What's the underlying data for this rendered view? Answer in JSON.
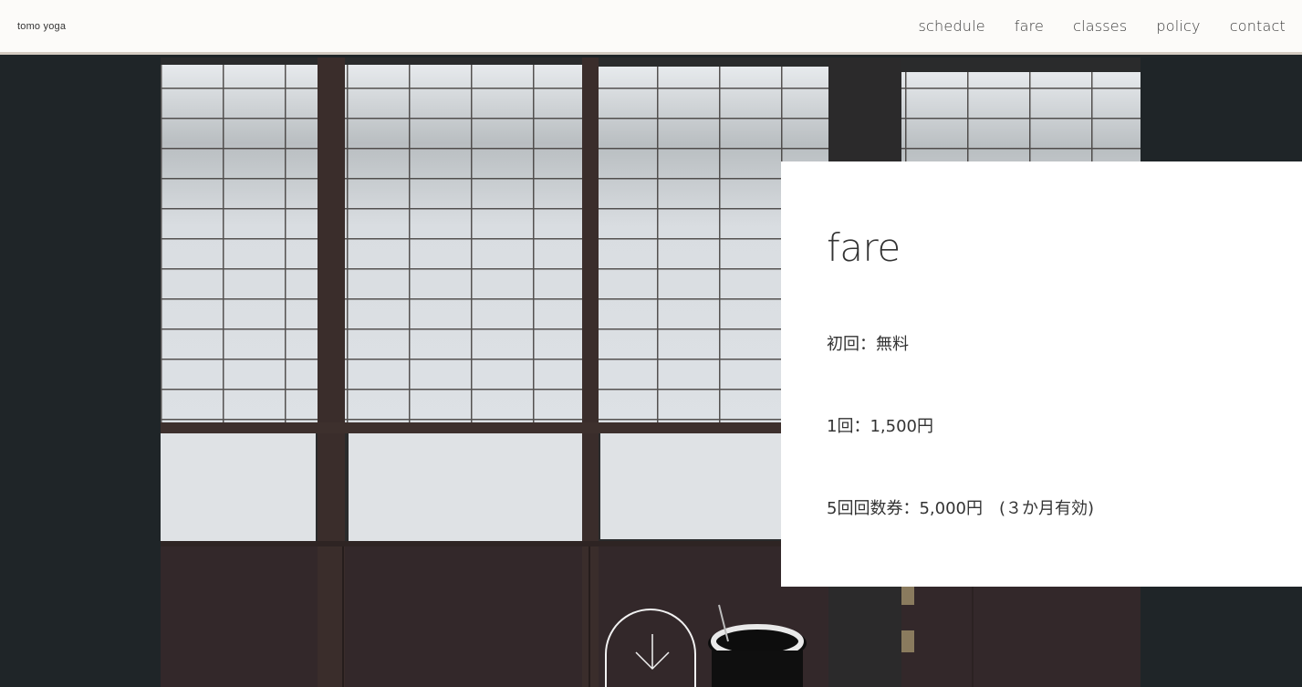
{
  "header": {
    "logo": "tomo yoga",
    "nav": [
      "schedule",
      "fare",
      "classes",
      "policy",
      "contact"
    ]
  },
  "fare": {
    "title": "fare",
    "lines": [
      "初回：無料",
      "1回：1,500円",
      "5回回数券：5,000円　(３か月有効)"
    ]
  },
  "icons": {
    "scroll": "arrow-down-icon"
  },
  "colors": {
    "header_bg": "#fcfbf9",
    "header_border": "#d4cbc2",
    "page_bg": "#1f2528",
    "card_bg": "#ffffff",
    "text": "#333333"
  }
}
